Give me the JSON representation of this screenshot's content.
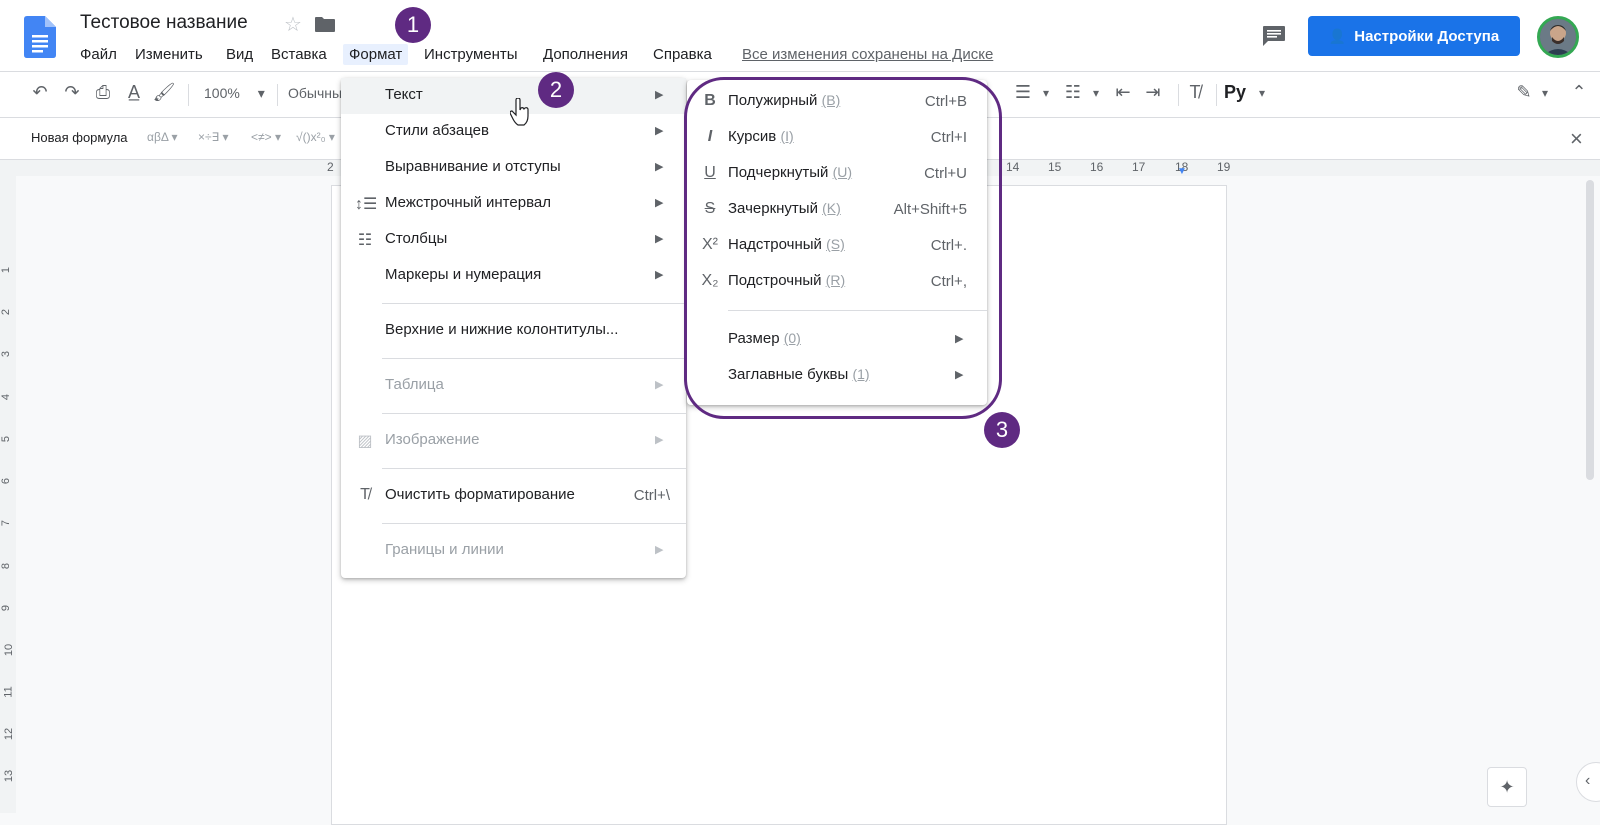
{
  "header": {
    "doc_title": "Тестовое название",
    "menus": [
      "Файл",
      "Изменить",
      "Вид",
      "Вставка",
      "Формат",
      "Инструменты",
      "Дополнения",
      "Справка"
    ],
    "saved_status": "Все изменения сохранены на Диске",
    "share_label": "Настройки Доступа"
  },
  "toolbar": {
    "zoom": "100%",
    "style": "Обычны",
    "input_tools": "Ру"
  },
  "equation_bar": {
    "new_formula": "Новая формула",
    "groups": [
      "αβΔ",
      "×÷∃",
      "<≠>",
      "√()x²₀"
    ]
  },
  "ruler": {
    "left_number": "2",
    "numbers": [
      "14",
      "15",
      "16",
      "17",
      "18",
      "19"
    ],
    "vertical_numbers": [
      "1",
      "2",
      "3",
      "4",
      "5",
      "6",
      "7",
      "8",
      "9",
      "10",
      "11",
      "12",
      "13"
    ]
  },
  "format_menu": {
    "items": [
      {
        "label": "Текст",
        "icon": "",
        "submenu": true,
        "disabled": false,
        "shortcut": ""
      },
      {
        "label": "Стили абзацев",
        "icon": "",
        "submenu": true,
        "disabled": false,
        "shortcut": ""
      },
      {
        "label": "Выравнивание и отступы",
        "icon": "",
        "submenu": true,
        "disabled": false,
        "shortcut": ""
      },
      {
        "label": "Межстрочный интервал",
        "icon": "line-spacing-icon",
        "submenu": true,
        "disabled": false,
        "shortcut": ""
      },
      {
        "label": "Столбцы",
        "icon": "columns-icon",
        "submenu": true,
        "disabled": false,
        "shortcut": ""
      },
      {
        "label": "Маркеры и нумерация",
        "icon": "",
        "submenu": true,
        "disabled": false,
        "shortcut": ""
      },
      {
        "label": "Верхние и нижние колонтитулы...",
        "icon": "",
        "submenu": false,
        "disabled": false,
        "shortcut": ""
      },
      {
        "label": "Таблица",
        "icon": "",
        "submenu": true,
        "disabled": true,
        "shortcut": ""
      },
      {
        "label": "Изображение",
        "icon": "image-icon",
        "submenu": true,
        "disabled": true,
        "shortcut": ""
      },
      {
        "label": "Очистить форматирование",
        "icon": "clear-formatting-icon",
        "submenu": false,
        "disabled": false,
        "shortcut": "Ctrl+\\"
      },
      {
        "label": "Границы и линии",
        "icon": "",
        "submenu": true,
        "disabled": true,
        "shortcut": ""
      }
    ]
  },
  "text_submenu": {
    "items": [
      {
        "label": "Полужирный",
        "hint": "(B)",
        "shortcut": "Ctrl+B",
        "icon": "bold-icon"
      },
      {
        "label": "Курсив",
        "hint": "(I)",
        "shortcut": "Ctrl+I",
        "icon": "italic-icon"
      },
      {
        "label": "Подчеркнутый",
        "hint": "(U)",
        "shortcut": "Ctrl+U",
        "icon": "underline-icon"
      },
      {
        "label": "Зачеркнутый",
        "hint": "(K)",
        "shortcut": "Alt+Shift+5",
        "icon": "strikethrough-icon"
      },
      {
        "label": "Надстрочный",
        "hint": "(S)",
        "shortcut": "Ctrl+.",
        "icon": "superscript-icon"
      },
      {
        "label": "Подстрочный",
        "hint": "(R)",
        "shortcut": "Ctrl+,",
        "icon": "subscript-icon"
      },
      {
        "label": "Размер",
        "hint": "(0)",
        "shortcut": "",
        "icon": ""
      },
      {
        "label": "Заглавные буквы",
        "hint": "(1)",
        "shortcut": "",
        "icon": ""
      }
    ]
  },
  "annotations": {
    "badges": [
      "1",
      "2",
      "3"
    ],
    "color": "#5f2a82"
  },
  "colors": {
    "accent": "#1a73e8",
    "annotation": "#5f2a82"
  }
}
